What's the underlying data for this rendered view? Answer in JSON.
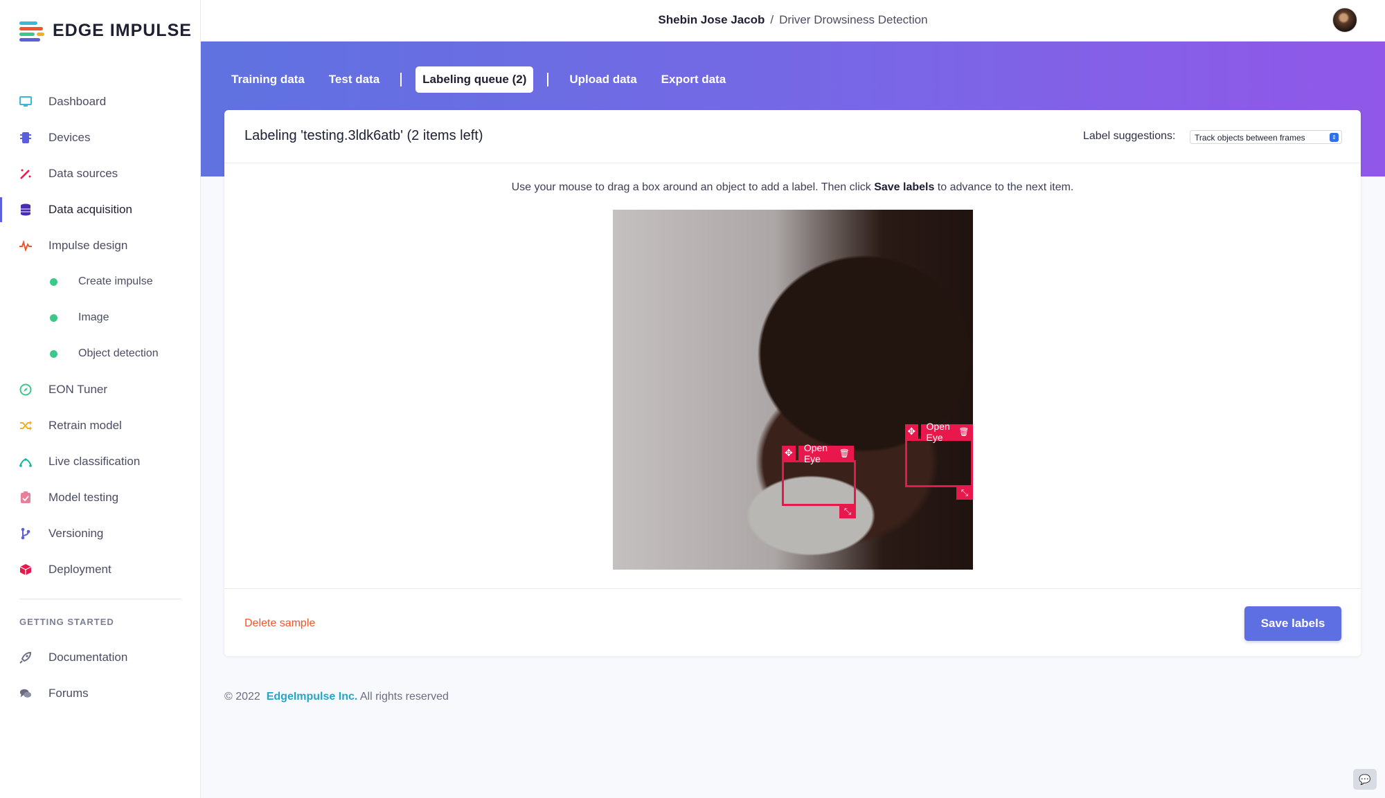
{
  "app": {
    "name": "EDGE IMPULSE"
  },
  "breadcrumb": {
    "user": "Shebin Jose Jacob",
    "separator": "/",
    "project": "Driver Drowsiness Detection"
  },
  "sidebar": {
    "items": [
      {
        "label": "Dashboard",
        "icon": "monitor-icon",
        "color": "#3bb8d9"
      },
      {
        "label": "Devices",
        "icon": "chip-icon",
        "color": "#5c5fdc"
      },
      {
        "label": "Data sources",
        "icon": "wand-icon",
        "color": "#e8184d"
      },
      {
        "label": "Data acquisition",
        "icon": "database-icon",
        "color": "#4a2bb5"
      },
      {
        "label": "Impulse design",
        "icon": "pulse-icon",
        "color": "#f0542d"
      },
      {
        "label": "Create impulse",
        "icon": "dot-icon",
        "color": "#3cc88a"
      },
      {
        "label": "Image",
        "icon": "dot-icon",
        "color": "#3cc88a"
      },
      {
        "label": "Object detection",
        "icon": "dot-icon",
        "color": "#3cc88a"
      },
      {
        "label": "EON Tuner",
        "icon": "compass-icon",
        "color": "#3cc88a"
      },
      {
        "label": "Retrain model",
        "icon": "shuffle-icon",
        "color": "#f2b01e"
      },
      {
        "label": "Live classification",
        "icon": "graph-icon",
        "color": "#18b39a"
      },
      {
        "label": "Model testing",
        "icon": "clipboard-icon",
        "color": "#e87f9a"
      },
      {
        "label": "Versioning",
        "icon": "branch-icon",
        "color": "#5c5fdc"
      },
      {
        "label": "Deployment",
        "icon": "box-icon",
        "color": "#e8184d"
      }
    ],
    "section_title": "GETTING STARTED",
    "getting_started": [
      {
        "label": "Documentation",
        "icon": "rocket-icon"
      },
      {
        "label": "Forums",
        "icon": "chat-icon"
      }
    ]
  },
  "tabs": [
    {
      "label": "Training data"
    },
    {
      "label": "Test data"
    },
    {
      "label": "Labeling queue (2)"
    },
    {
      "label": "Upload data"
    },
    {
      "label": "Export data"
    }
  ],
  "card": {
    "title": "Labeling 'testing.3ldk6atb' (2 items left)",
    "suggestions_label": "Label suggestions:",
    "suggestions_value": "Track objects between frames",
    "instructions_pre": "Use your mouse to drag a box around an object to add a label. Then click ",
    "instructions_bold": "Save labels",
    "instructions_post": " to advance to the next item.",
    "boxes": [
      {
        "label": "Open Eye"
      },
      {
        "label": "Open Eye"
      }
    ],
    "delete_label": "Delete sample",
    "save_label": "Save labels"
  },
  "footer": {
    "copyright": "© 2022",
    "company": "EdgeImpulse Inc.",
    "rights": "All rights reserved"
  },
  "colors": {
    "accent": "#5e6ee3",
    "box": "#e8184d",
    "danger": "#f0542d"
  }
}
